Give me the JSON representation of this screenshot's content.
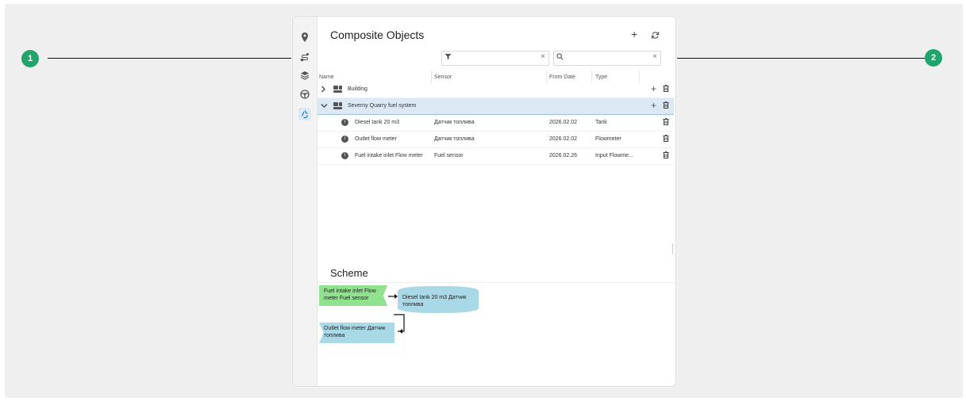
{
  "header": {
    "title": "Composite Objects",
    "add_icon": "plus-icon",
    "refresh_icon": "refresh-icon"
  },
  "sidebar": {
    "items": [
      {
        "name": "location-pin-icon",
        "glyph": "⬤"
      },
      {
        "name": "route-icon",
        "glyph": "⟿"
      },
      {
        "name": "layers-icon",
        "glyph": "≋"
      },
      {
        "name": "steering-wheel-icon",
        "glyph": "⊛"
      },
      {
        "name": "recycle-icon",
        "glyph": "♻",
        "active": true
      }
    ]
  },
  "filter": {
    "value": "",
    "placeholder": "",
    "clear": "×",
    "icon": "▼"
  },
  "search": {
    "value": "",
    "placeholder": "",
    "clear": "×",
    "icon": "⌕"
  },
  "table": {
    "columns": [
      "Name",
      "Sensor",
      "From Date",
      "Type"
    ],
    "groups": [
      {
        "name": "Building",
        "expanded": false,
        "chevron": "›"
      },
      {
        "name": "Severny Quarry fuel system",
        "expanded": true,
        "chevron": "⌄",
        "children": [
          {
            "name": "Diesel tank 20 m3",
            "sensor": "Датчик топлива",
            "from_date": "2026.02.02",
            "type": "Tank"
          },
          {
            "name": "Outlet flow meter",
            "sensor": "Датчик топлива",
            "from_date": "2026.02.02",
            "type": "Flowmeter"
          },
          {
            "name": "Fuel intake inlet Flow meter",
            "sensor": "Fuel sensor",
            "from_date": "2026.02.26",
            "type": "Input Flowme..."
          }
        ]
      }
    ],
    "plus": "+",
    "trash": "🗑"
  },
  "scheme": {
    "title": "Scheme",
    "nodes": {
      "inlet": "Fuel intake inlet Flow meter Fuel sensor",
      "tank": "Diesel tank 20 m3 Датчик топлива",
      "outlet": "Outlet flow meter Датчик топлива"
    },
    "colors": {
      "inlet": "#90e28f",
      "tank": "#a9d8e6",
      "outlet": "#a9d8e6"
    }
  },
  "callouts": {
    "one": "1",
    "two": "2"
  },
  "colors": {
    "callout": "#21a56b",
    "selected_row": "#dce9f5",
    "accent": "#2a7fc6"
  }
}
